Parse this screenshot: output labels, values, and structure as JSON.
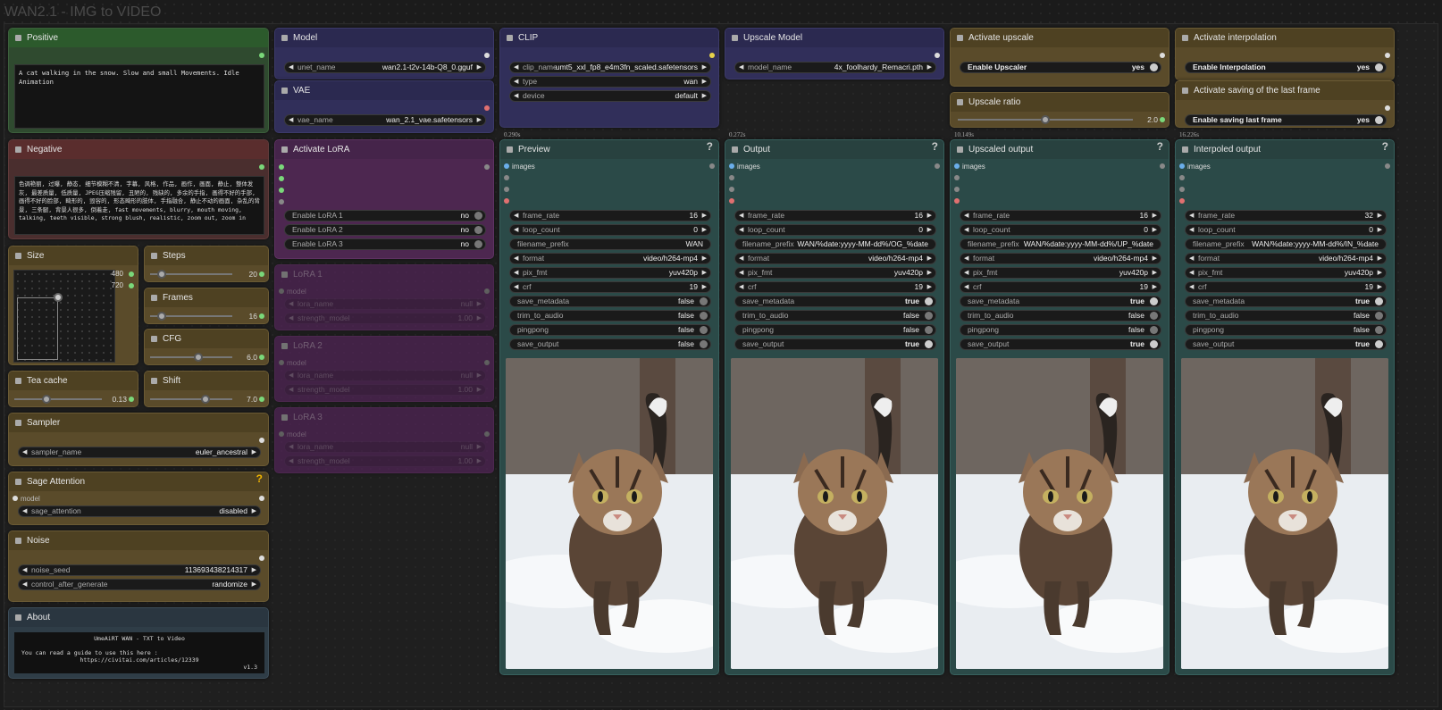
{
  "workflow_title": "WAN2.1 - IMG to VIDEO",
  "positive": {
    "title": "Positive",
    "text": "A cat walking in the snow. Slow and small Movements. Idle Animation"
  },
  "negative": {
    "title": "Negative",
    "text": "色调艳丽, 过曝, 静态, 细节模糊不清, 字幕, 风格, 作品, 画作, 画面, 静止, 整体发灰, 最差质量, 低质量, JPEG压缩残留, 丑陋的, 残缺的, 多余的手指, 画得不好的手部, 画得不好的脸部, 畸形的, 毁容的, 形态畸形的肢体, 手指融合, 静止不动的画面, 杂乱的背景, 三条腿, 背景人很多, 倒着走, fast movements, blurry, mouth moving, talking, teeth visible, strong blush, realistic, zoom out, zoom in"
  },
  "size": {
    "title": "Size",
    "width": "480",
    "height": "720"
  },
  "steps": {
    "title": "Steps",
    "value": "20",
    "level": 0.1
  },
  "frames": {
    "title": "Frames",
    "value": "16",
    "level": 0.1
  },
  "cfg": {
    "title": "CFG",
    "value": "6.0",
    "level": 0.6
  },
  "teacache": {
    "title": "Tea cache",
    "value": "0.13",
    "level": 0.35
  },
  "shift": {
    "title": "Shift",
    "value": "7.0",
    "level": 0.7
  },
  "sampler": {
    "title": "Sampler",
    "label": "sampler_name",
    "value": "euler_ancestral"
  },
  "sage": {
    "title": "Sage Attention",
    "input": "model",
    "label": "sage_attention",
    "value": "disabled"
  },
  "noise": {
    "title": "Noise",
    "seed_label": "noise_seed",
    "seed": "113693438214317",
    "cag_label": "control_after_generate",
    "cag": "randomize"
  },
  "about": {
    "title": "About",
    "line1": "UmeAiRT WAN - TXT to Video",
    "line2": "You can read a guide to use this here :",
    "line3": "https://civitai.com/articles/12339",
    "version": "v1.3"
  },
  "model": {
    "title": "Model",
    "label": "unet_name",
    "value": "wan2.1-t2v-14b-Q8_0.gguf"
  },
  "vae": {
    "title": "VAE",
    "label": "vae_name",
    "value": "wan_2.1_vae.safetensors"
  },
  "activate_lora": {
    "title": "Activate LoRA",
    "toggles": [
      {
        "label": "Enable LoRA 1",
        "value": "no"
      },
      {
        "label": "Enable LoRA 2",
        "value": "no"
      },
      {
        "label": "Enable LoRA 3",
        "value": "no"
      }
    ]
  },
  "loras": [
    {
      "title": "LoRA 1",
      "input": "model",
      "name_label": "lora_name",
      "name": "null",
      "strength_label": "strength_model",
      "strength": "1.00"
    },
    {
      "title": "LoRA 2",
      "input": "model",
      "name_label": "lora_name",
      "name": "null",
      "strength_label": "strength_model",
      "strength": "1.00"
    },
    {
      "title": "LoRA 3",
      "input": "model",
      "name_label": "lora_name",
      "name": "null",
      "strength_label": "strength_model",
      "strength": "1.00"
    }
  ],
  "clip": {
    "title": "CLIP",
    "name_label": "clip_name",
    "name": "umt5_xxl_fp8_e4m3fn_scaled.safetensors",
    "type_label": "type",
    "type": "wan",
    "device_label": "device",
    "device": "default",
    "timing": "0.290s"
  },
  "upscale_model": {
    "title": "Upscale Model",
    "label": "model_name",
    "value": "4x_foolhardy_Remacri.pth",
    "timing": "0.272s"
  },
  "activate_upscale": {
    "title": "Activate upscale",
    "label": "Enable Upscaler",
    "value": "yes"
  },
  "upscale_ratio": {
    "title": "Upscale ratio",
    "value": "2.0",
    "level": 0.5,
    "timing": "10.149s"
  },
  "activate_interp": {
    "title": "Activate interpolation",
    "label": "Enable Interpolation",
    "value": "yes"
  },
  "activate_save_last": {
    "title": "Activate saving of the last frame",
    "label": "Enable saving last frame",
    "value": "yes",
    "timing": "16.226s"
  },
  "field_labels": {
    "images": "images",
    "frame_rate": "frame_rate",
    "loop_count": "loop_count",
    "filename_prefix": "filename_prefix",
    "format": "format",
    "pix_fmt": "pix_fmt",
    "crf": "crf",
    "save_metadata": "save_metadata",
    "trim_to_audio": "trim_to_audio",
    "pingpong": "pingpong",
    "save_output": "save_output",
    "help": "?"
  },
  "outputs": [
    {
      "title": "Preview",
      "frame_rate": "16",
      "loop_count": "0",
      "filename_prefix": "WAN",
      "format": "video/h264-mp4",
      "pix_fmt": "yuv420p",
      "crf": "19",
      "save_metadata": "false",
      "trim_to_audio": "false",
      "pingpong": "false",
      "save_output": "false"
    },
    {
      "title": "Output",
      "frame_rate": "16",
      "loop_count": "0",
      "filename_prefix": "WAN/%date:yyyy-MM-dd%/OG_%date",
      "format": "video/h264-mp4",
      "pix_fmt": "yuv420p",
      "crf": "19",
      "save_metadata": "true",
      "trim_to_audio": "false",
      "pingpong": "false",
      "save_output": "true"
    },
    {
      "title": "Upscaled output",
      "frame_rate": "16",
      "loop_count": "0",
      "filename_prefix": "WAN/%date:yyyy-MM-dd%/UP_%date",
      "format": "video/h264-mp4",
      "pix_fmt": "yuv420p",
      "crf": "19",
      "save_metadata": "true",
      "trim_to_audio": "false",
      "pingpong": "false",
      "save_output": "true"
    },
    {
      "title": "Interpoled output",
      "frame_rate": "32",
      "loop_count": "0",
      "filename_prefix": "WAN/%date:yyyy-MM-dd%/IN_%date",
      "format": "video/h264-mp4",
      "pix_fmt": "yuv420p",
      "crf": "19",
      "save_metadata": "true",
      "trim_to_audio": "false",
      "pingpong": "false",
      "save_output": "true"
    }
  ],
  "colors": {
    "green_node": "#2f4a2f",
    "red_node": "#4a2e2e",
    "olive_node": "#5a4b2a",
    "purple_node": "#312f5a",
    "magenta_node": "#4d2750",
    "teal_node": "#2b4a48",
    "slate_node": "#2f3d47"
  }
}
